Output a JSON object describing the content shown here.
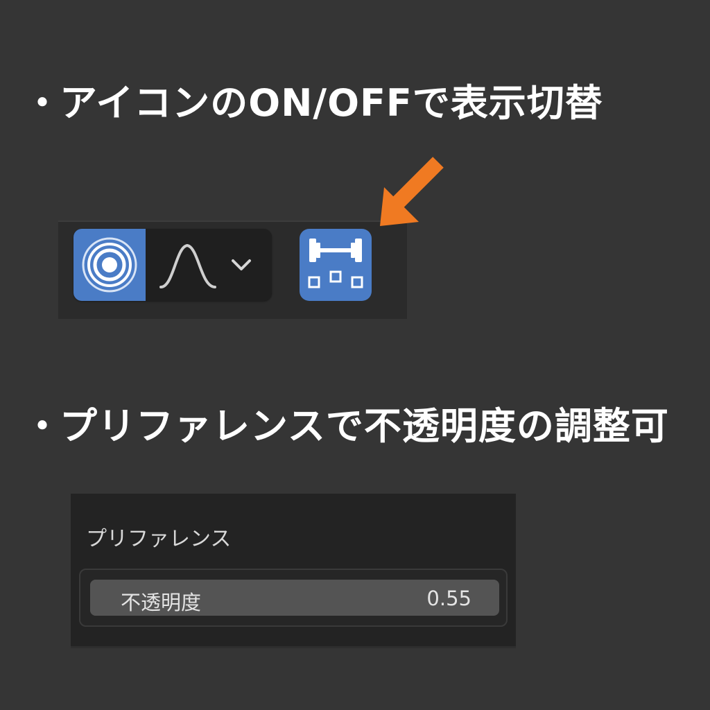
{
  "sections": [
    {
      "bullet": "・",
      "title": "アイコンのON/OFFで表示切替"
    },
    {
      "bullet": "・",
      "title": "プリファレンスで不透明度の調整可"
    }
  ],
  "toolbar": {
    "overlays_toggle": {
      "icon": "overlays-icon",
      "state": "on"
    },
    "overlays_dropdown": {
      "icons": [
        "bell-curve-icon",
        "chevron-down-icon"
      ]
    },
    "gizmo_toggle": {
      "icon": "dumbbell-grid-icon",
      "state": "on"
    },
    "pointer": {
      "icon": "arrow-down-left-icon"
    }
  },
  "preferences": {
    "title": "プリファレンス",
    "opacity": {
      "label": "不透明度",
      "value_text": "0.55",
      "value": 0.55
    }
  },
  "colors": {
    "background": "#353535",
    "toggle_active": "#4a7cc6",
    "accent_arrow": "#f07a22",
    "panel": "#232323",
    "slider": "#545454"
  }
}
